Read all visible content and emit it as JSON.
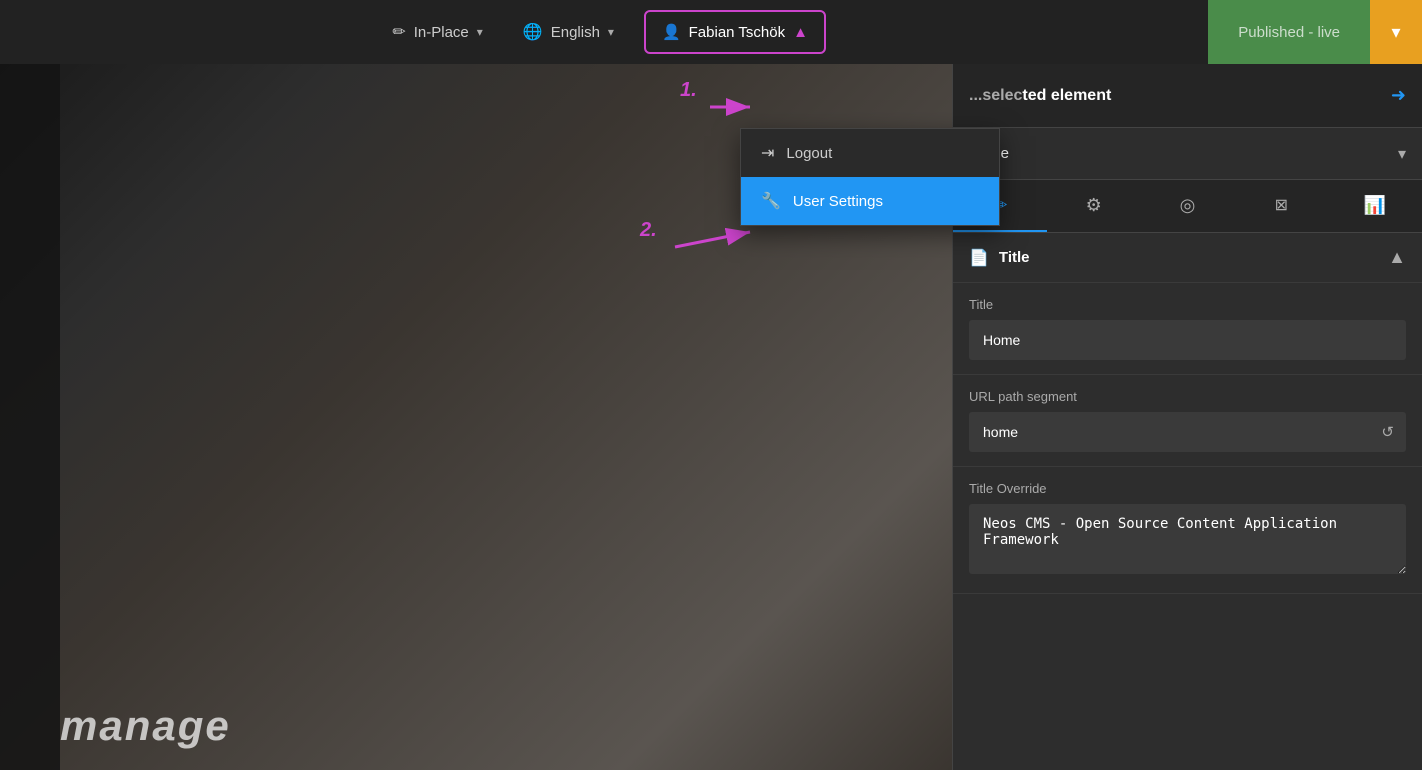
{
  "topbar": {
    "inplace_label": "In-Place",
    "language_label": "English",
    "user_label": "Fabian Tschök",
    "published_label": "Published - live",
    "step1_label": "1.",
    "step2_label": "2."
  },
  "dropdown": {
    "logout_label": "Logout",
    "user_settings_label": "User Settings"
  },
  "right_panel": {
    "header_title": "ted element",
    "page_value": "Home",
    "tabs": [
      {
        "icon": "✏️",
        "label": "edit",
        "active": true
      },
      {
        "icon": "⚙️",
        "label": "settings",
        "active": false
      },
      {
        "icon": "◎",
        "label": "target",
        "active": false
      },
      {
        "icon": "✂️",
        "label": "crop",
        "active": false
      },
      {
        "icon": "📊",
        "label": "chart",
        "active": false
      }
    ],
    "section_title": "Title",
    "fields": [
      {
        "label": "Title",
        "value": "Home",
        "type": "input"
      },
      {
        "label": "URL path segment",
        "value": "home",
        "type": "input-icon",
        "icon": "↺"
      },
      {
        "label": "Title Override",
        "value": "Neos CMS - Open Source Content Application Framework",
        "type": "textarea"
      }
    ]
  },
  "colors": {
    "accent_blue": "#2196f3",
    "accent_green": "#4a8c4a",
    "accent_orange": "#e8a020",
    "accent_magenta": "#cc44cc"
  }
}
